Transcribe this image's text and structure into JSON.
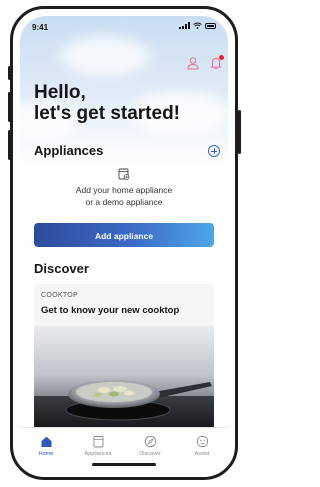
{
  "status_bar": {
    "time": "9:41"
  },
  "icons": {
    "profile": "person-icon",
    "notifications": "bell-icon",
    "add": "plus-circle-icon",
    "appliance": "appliance-plus-icon"
  },
  "greeting": {
    "line1": "Hello,",
    "line2": "let's get started!"
  },
  "appliances": {
    "title": "Appliances",
    "empty_line1": "Add your home appliance",
    "empty_line2": "or a demo appliance",
    "add_button_label": "Add appliance"
  },
  "discover": {
    "title": "Discover",
    "card": {
      "kicker": "COOKTOP",
      "title": "Get to know your new cooktop",
      "image": "pan-on-cooktop-photo"
    }
  },
  "tabbar": {
    "items": [
      {
        "label": "Home",
        "icon": "home-icon",
        "active": true
      },
      {
        "label": "Appliances",
        "icon": "appliances-icon",
        "active": false
      },
      {
        "label": "Discover",
        "icon": "compass-icon",
        "active": false
      },
      {
        "label": "Assist",
        "icon": "smiley-icon",
        "active": false
      }
    ]
  },
  "colors": {
    "accent": "#2f58b8",
    "notification_dot": "#e8233c",
    "button_gradient_start": "#2d4b9a",
    "button_gradient_end": "#4fa6e6"
  }
}
